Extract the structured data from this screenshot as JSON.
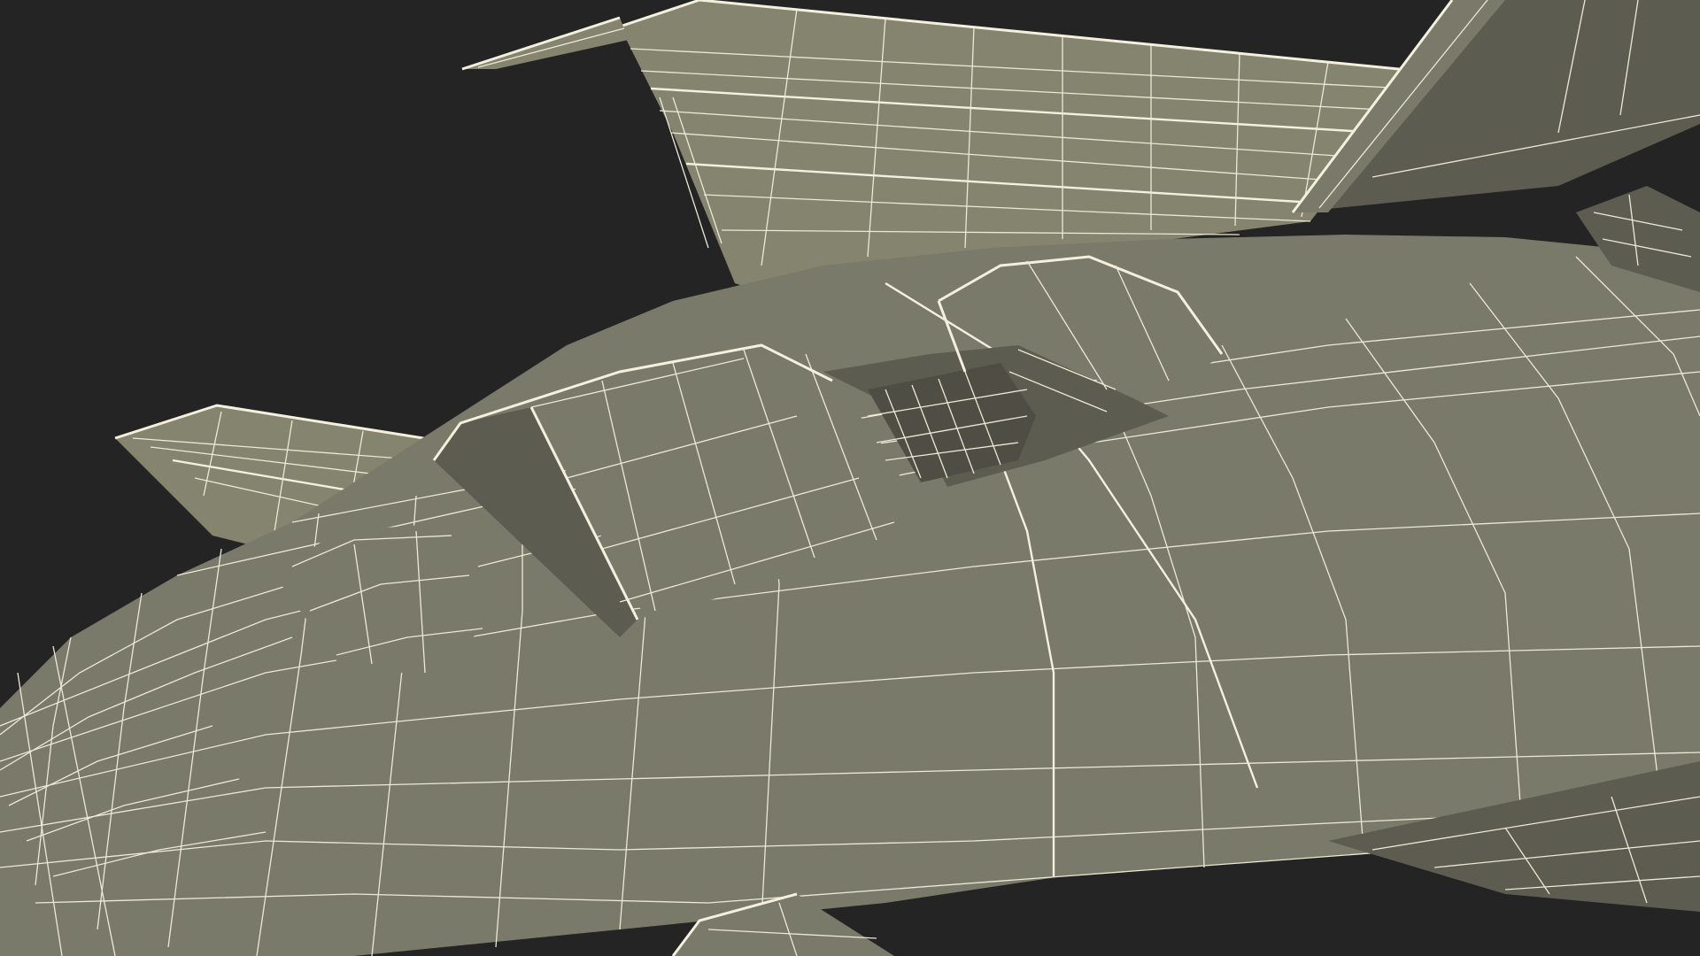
{
  "scene": {
    "subject": "aircraft-wireframe-model",
    "colors": {
      "background": "#242424",
      "surface": "#7a7a6a",
      "surface_dark": "#5c5c50",
      "wire": "#ece9d6"
    }
  }
}
